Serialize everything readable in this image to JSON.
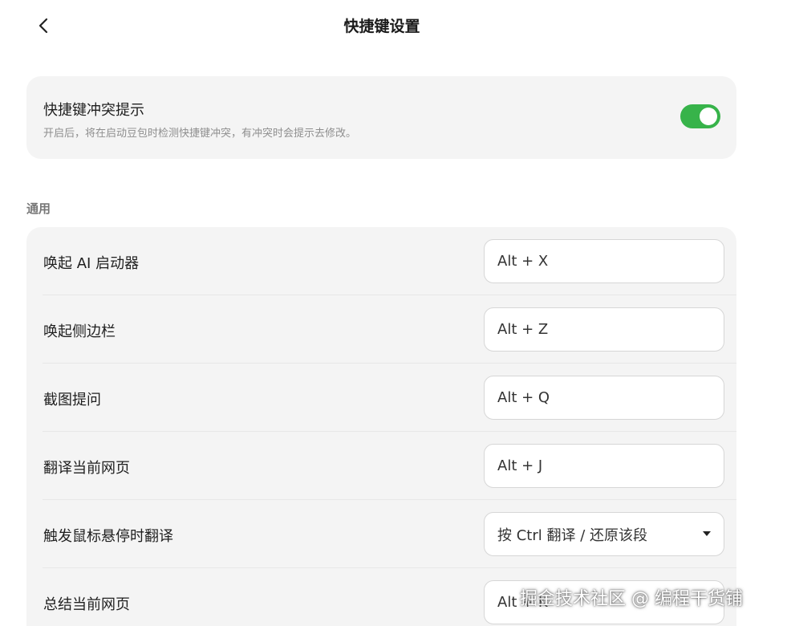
{
  "header": {
    "title": "快捷键设置",
    "back_icon": "chevron-left-icon"
  },
  "conflict_alert": {
    "title": "快捷键冲突提示",
    "description": "开启后，将在启动豆包时检测快捷键冲突，有冲突时会提示去修改。",
    "toggle_on": true,
    "toggle_color": "#37b34a"
  },
  "general": {
    "section_label": "通用",
    "items": [
      {
        "label": "唤起 AI 启动器",
        "value": "Alt + X"
      },
      {
        "label": "唤起侧边栏",
        "value": "Alt + Z"
      },
      {
        "label": "截图提问",
        "value": "Alt + Q"
      },
      {
        "label": "翻译当前网页",
        "value": "Alt + J"
      },
      {
        "label": "触发鼠标悬停时翻译",
        "value": "按 Ctrl 翻译 / 还原该段",
        "dropdown_icon": "caret-down-icon"
      },
      {
        "label": "总结当前网页",
        "value": "Alt + K"
      }
    ]
  },
  "watermark": "掘金技术社区 @ 编程干货铺",
  "colors": {
    "card_background": "#f4f4f4",
    "section_label": "#777777",
    "description_text": "#8e8e8e"
  }
}
